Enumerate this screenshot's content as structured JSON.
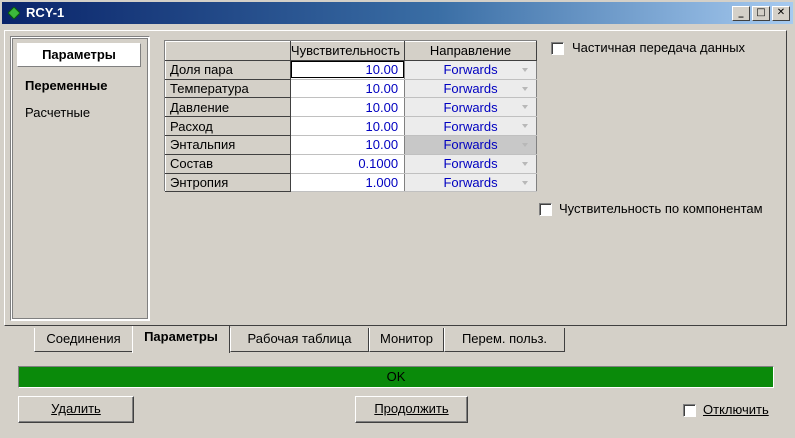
{
  "window": {
    "title": "RCY-1",
    "minimize": "_",
    "maximize": "□",
    "close": "✕"
  },
  "sidebar": {
    "header": "Параметры",
    "items": [
      {
        "label": "Переменные",
        "selected": true
      },
      {
        "label": "Расчетные",
        "selected": false
      }
    ]
  },
  "table": {
    "headers": [
      "Чувствительность",
      "Направление"
    ],
    "rows": [
      {
        "label": "Доля пара",
        "sensitivity": "10.00",
        "direction": "Forwards"
      },
      {
        "label": "Температура",
        "sensitivity": "10.00",
        "direction": "Forwards"
      },
      {
        "label": "Давление",
        "sensitivity": "10.00",
        "direction": "Forwards"
      },
      {
        "label": "Расход",
        "sensitivity": "10.00",
        "direction": "Forwards"
      },
      {
        "label": "Энтальпия",
        "sensitivity": "10.00",
        "direction": "Forwards"
      },
      {
        "label": "Состав",
        "sensitivity": "0.1000",
        "direction": "Forwards"
      },
      {
        "label": "Энтропия",
        "sensitivity": "1.000",
        "direction": "Forwards"
      }
    ]
  },
  "options": {
    "partial_transfer": {
      "label": "Частичная передача данных",
      "checked": false
    },
    "component_sensitivity": {
      "label": "Чуствительность по компонентам",
      "checked": false
    }
  },
  "tabs": [
    {
      "label": "Соединения",
      "active": false
    },
    {
      "label": "Параметры",
      "active": true
    },
    {
      "label": "Рабочая таблица",
      "active": false
    },
    {
      "label": "Монитор",
      "active": false
    },
    {
      "label": "Перем. польз.",
      "active": false
    }
  ],
  "status": {
    "text": "OK",
    "color": "#0a8a0a"
  },
  "buttons": {
    "delete": {
      "label": "Удалить"
    },
    "continue": {
      "label": "Продолжить"
    },
    "disable": {
      "label": "Отключить",
      "checked": false
    }
  }
}
